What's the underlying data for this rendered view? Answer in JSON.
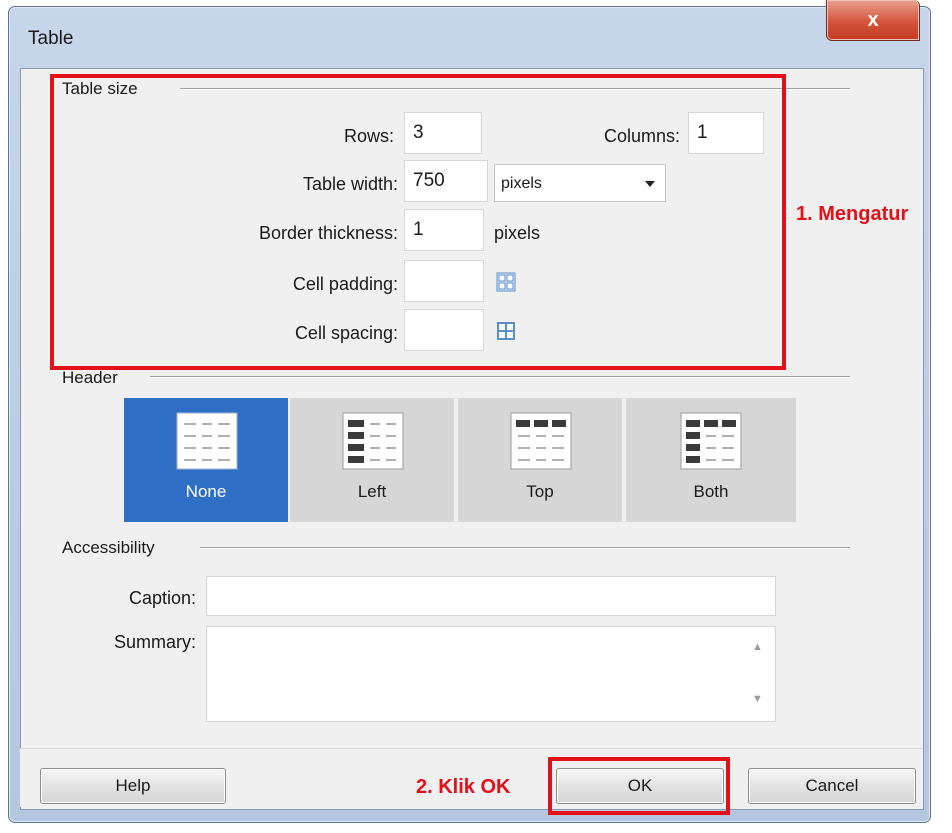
{
  "window": {
    "title": "Table",
    "close_label": "x"
  },
  "table_size": {
    "section_label": "Table size",
    "rows": {
      "label": "Rows:",
      "value": "3"
    },
    "columns": {
      "label": "Columns:",
      "value": "1"
    },
    "table_width": {
      "label": "Table width:",
      "value": "750",
      "unit_selected": "pixels"
    },
    "border_thickness": {
      "label": "Border thickness:",
      "value": "1",
      "unit": "pixels"
    },
    "cell_padding": {
      "label": "Cell padding:",
      "value": "",
      "icon": "cell-padding-icon"
    },
    "cell_spacing": {
      "label": "Cell spacing:",
      "value": "",
      "icon": "cell-spacing-icon"
    }
  },
  "header": {
    "section_label": "Header",
    "options": [
      {
        "label": "None",
        "selected": true
      },
      {
        "label": "Left",
        "selected": false
      },
      {
        "label": "Top",
        "selected": false
      },
      {
        "label": "Both",
        "selected": false
      }
    ]
  },
  "accessibility": {
    "section_label": "Accessibility",
    "caption": {
      "label": "Caption:",
      "value": ""
    },
    "summary": {
      "label": "Summary:",
      "value": ""
    }
  },
  "buttons": {
    "help": "Help",
    "ok": "OK",
    "cancel": "Cancel"
  },
  "annotations": {
    "step1": "1. Mengatur",
    "step2": "2. Klik OK"
  },
  "colors": {
    "selected_header": "#2f6fc6",
    "annotation_red": "#e3101a"
  }
}
